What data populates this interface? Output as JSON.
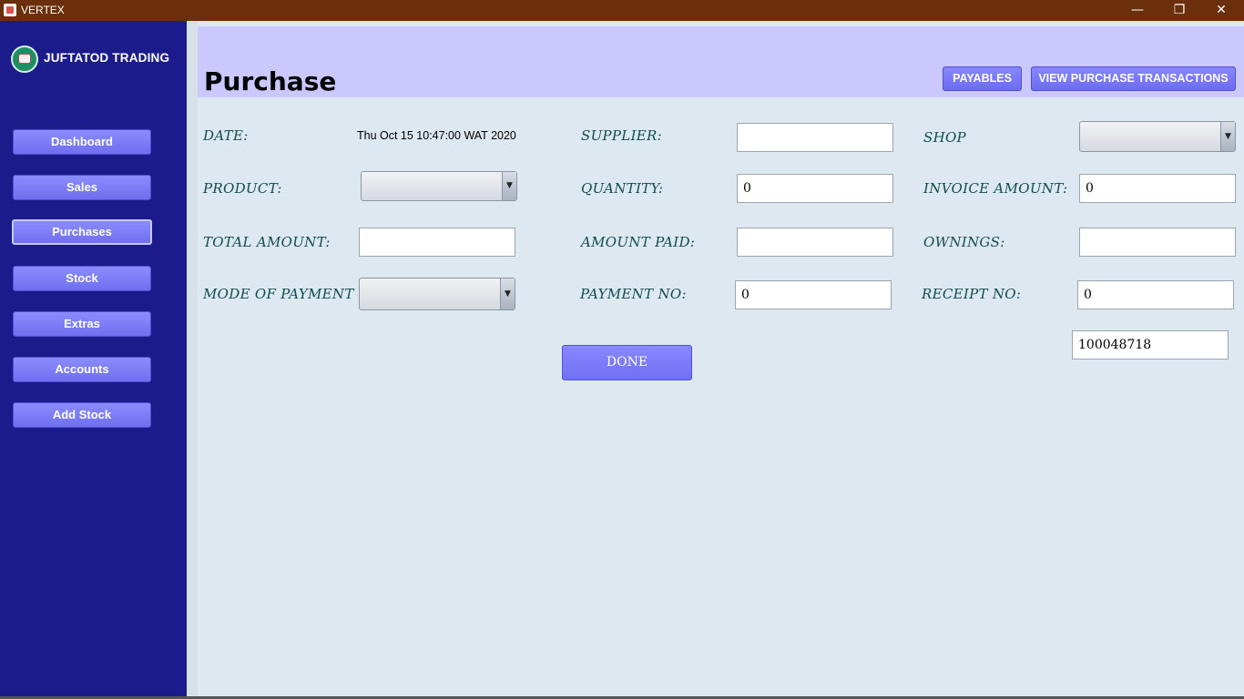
{
  "window": {
    "title": "VERTEX",
    "minimize": "—",
    "maximize": "❐",
    "close": "✕"
  },
  "sidebar": {
    "brand": "JUFTATOD TRADING",
    "items": [
      {
        "label": "Dashboard"
      },
      {
        "label": "Sales"
      },
      {
        "label": "Purchases"
      },
      {
        "label": "Stock"
      },
      {
        "label": "Extras"
      },
      {
        "label": "Accounts"
      },
      {
        "label": "Add Stock"
      }
    ]
  },
  "header": {
    "title": "Purchase",
    "payables_label": "PAYABLES",
    "view_transactions_label": "VIEW PURCHASE TRANSACTIONS"
  },
  "form": {
    "date_label": "DATE:",
    "date_value": "Thu Oct 15 10:47:00 WAT 2020",
    "supplier_label": "SUPPLIER:",
    "supplier_value": "",
    "shop_label": "SHOP",
    "shop_value": "",
    "product_label": "PRODUCT:",
    "product_value": "",
    "quantity_label": "QUANTITY:",
    "quantity_value": "0",
    "invoice_amount_label": "INVOICE AMOUNT:",
    "invoice_amount_value": "0",
    "total_amount_label": "TOTAL AMOUNT:",
    "total_amount_value": "",
    "amount_paid_label": "AMOUNT PAID:",
    "amount_paid_value": "",
    "ownings_label": "OWNINGS:",
    "ownings_value": "",
    "mode_of_payment_label": "MODE OF PAYMENT",
    "mode_of_payment_value": "",
    "payment_no_label": "PAYMENT NO:",
    "payment_no_value": "0",
    "receipt_no_label": "RECEIPT NO:",
    "receipt_no_value": "0",
    "id_value": "100048718",
    "done_label": "DONE"
  }
}
